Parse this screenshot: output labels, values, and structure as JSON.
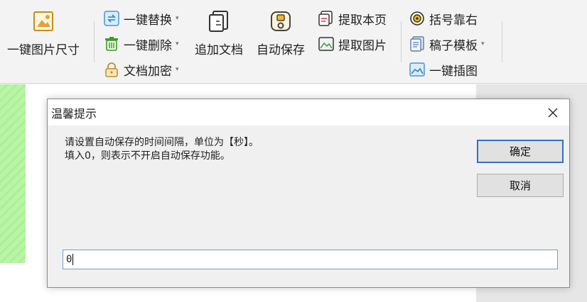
{
  "toolbar": {
    "image_size": "一键图片尺寸",
    "replace": "一键替换",
    "delete": "一键删除",
    "encrypt": "文档加密",
    "append_doc": "追加文档",
    "autosave": "自动保存",
    "extract_page": "提取本页",
    "extract_image": "提取图片",
    "bracket_right": "括号靠右",
    "template": "稿子模板",
    "insert_image": "一键插图",
    "caret": "▾"
  },
  "icons": [
    "image-size-icon",
    "replace-icon",
    "trash-icon",
    "lock-icon",
    "append-doc-icon",
    "autosave-icon",
    "extract-page-icon",
    "extract-image-icon",
    "bracket-icon",
    "template-icon",
    "insert-image-icon",
    "close-icon"
  ],
  "dialog": {
    "title": "温馨提示",
    "close": "✕",
    "line1": "请设置自动保存的时间间隔，单位为【秒】。",
    "line2": "填入0，则表示不开启自动保存功能。",
    "ok_label": "确定",
    "cancel_label": "取消",
    "input_value": "0"
  },
  "colors": {
    "accent": "#2d72c9",
    "green_strip": "#b9f5a6"
  }
}
